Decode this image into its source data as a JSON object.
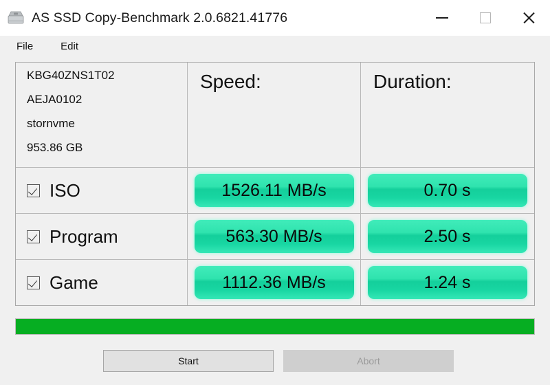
{
  "window": {
    "title": "AS SSD Copy-Benchmark 2.0.6821.41776",
    "icon": "ssd-drive-icon",
    "controls": {
      "minimize": "minimize-icon",
      "maximize": "maximize-icon",
      "close": "close-icon"
    }
  },
  "menubar": {
    "items": [
      {
        "label": "File"
      },
      {
        "label": "Edit"
      }
    ]
  },
  "table": {
    "drive": {
      "model": "KBG40ZNS1T02",
      "firmware": "AEJA0102",
      "driver": "stornvme",
      "capacity": "953.86 GB"
    },
    "headers": {
      "speed": "Speed:",
      "duration": "Duration:"
    },
    "rows": [
      {
        "name": "ISO",
        "checked": true,
        "speed": "1526.11 MB/s",
        "duration": "0.70 s"
      },
      {
        "name": "Program",
        "checked": true,
        "speed": "563.30 MB/s",
        "duration": "2.50 s"
      },
      {
        "name": "Game",
        "checked": true,
        "speed": "1112.36 MB/s",
        "duration": "1.24 s"
      }
    ]
  },
  "progress": {
    "percent": 100,
    "fill_color": "#06ae22"
  },
  "buttons": {
    "start": "Start",
    "abort": "Abort"
  },
  "colors": {
    "result_green_light": "#41ecba",
    "result_green_dark": "#14cf9b",
    "progress_green": "#06ae22",
    "window_bg": "#f0f0f0"
  }
}
